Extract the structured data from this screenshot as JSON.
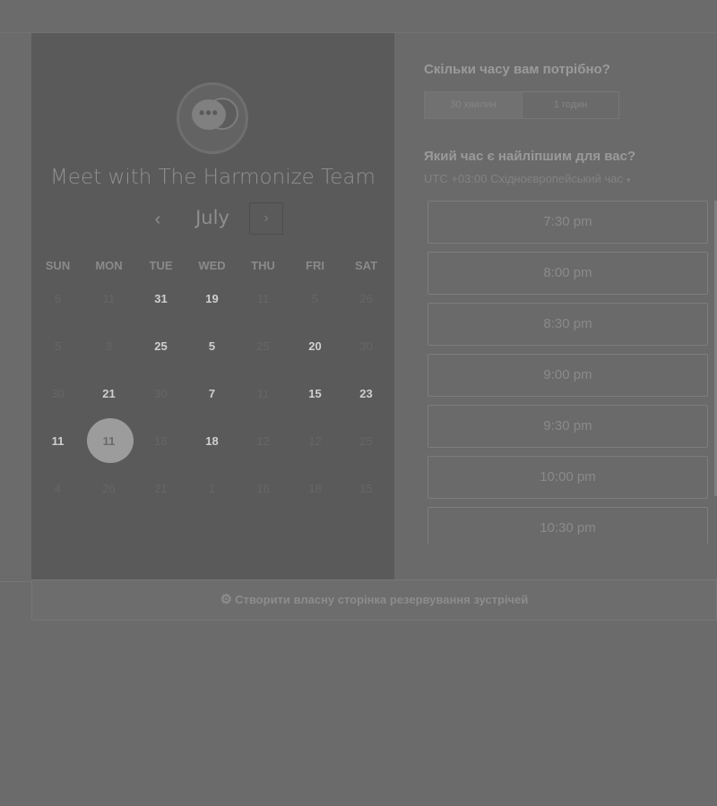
{
  "meeting": {
    "title": "Meet with The Harmonize Team",
    "logo_icon": "chat-bubbles-icon",
    "logo_dots": "•••"
  },
  "calendar": {
    "month": "July",
    "prev_icon": "‹",
    "next_icon": "›",
    "weekdays": [
      "SUN",
      "MON",
      "TUE",
      "WED",
      "THU",
      "FRI",
      "SAT"
    ],
    "weeks": [
      [
        {
          "d": "6",
          "s": "dim"
        },
        {
          "d": "11",
          "s": "dim"
        },
        {
          "d": "31",
          "s": "bright"
        },
        {
          "d": "19",
          "s": "bright"
        },
        {
          "d": "11",
          "s": "dim"
        },
        {
          "d": "5",
          "s": "dim"
        },
        {
          "d": "26",
          "s": "dim"
        }
      ],
      [
        {
          "d": "5",
          "s": "dim"
        },
        {
          "d": "3",
          "s": "dim"
        },
        {
          "d": "25",
          "s": "bright"
        },
        {
          "d": "5",
          "s": "bright"
        },
        {
          "d": "25",
          "s": "dim"
        },
        {
          "d": "20",
          "s": "bright"
        },
        {
          "d": "30",
          "s": "dim"
        }
      ],
      [
        {
          "d": "30",
          "s": "dim"
        },
        {
          "d": "21",
          "s": "bright"
        },
        {
          "d": "30",
          "s": "dim"
        },
        {
          "d": "7",
          "s": "bright"
        },
        {
          "d": "11",
          "s": "dim"
        },
        {
          "d": "15",
          "s": "bright"
        },
        {
          "d": "23",
          "s": "bright"
        }
      ],
      [
        {
          "d": "11",
          "s": "bright"
        },
        {
          "d": "11",
          "s": "selected"
        },
        {
          "d": "16",
          "s": "dim"
        },
        {
          "d": "18",
          "s": "bright"
        },
        {
          "d": "12",
          "s": "dim"
        },
        {
          "d": "12",
          "s": "dim"
        },
        {
          "d": "25",
          "s": "dim"
        }
      ],
      [
        {
          "d": "4",
          "s": "dim"
        },
        {
          "d": "26",
          "s": "dim"
        },
        {
          "d": "21",
          "s": "dim"
        },
        {
          "d": "1",
          "s": "dim"
        },
        {
          "d": "16",
          "s": "dim"
        },
        {
          "d": "18",
          "s": "dim"
        },
        {
          "d": "15",
          "s": "dim"
        }
      ]
    ]
  },
  "duration": {
    "question": "Скільки часу вам потрібно?",
    "options": [
      "30 хвилин",
      "1 годин"
    ],
    "selected": "30 хвилин"
  },
  "time": {
    "question": "Який час є найліпшим для вас?",
    "timezone": "UTC +03:00 Східноєвропейський час",
    "timezone_arrow": "▾",
    "slots": [
      "7:30 pm",
      "8:00 pm",
      "8:30 pm",
      "9:00 pm",
      "9:30 pm",
      "10:00 pm",
      "10:30 pm"
    ]
  },
  "footer": {
    "icon": "sprocket-icon",
    "icon_glyph": "⚙",
    "label": "Створити власну сторінка резервування зустрічей"
  }
}
